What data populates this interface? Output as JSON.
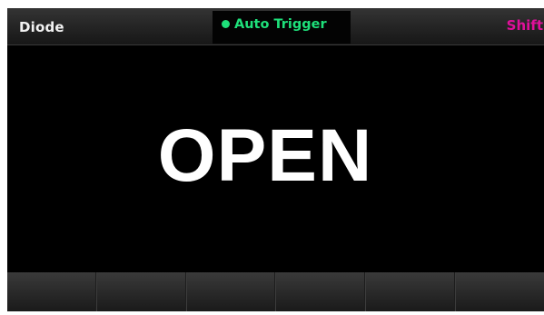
{
  "status_bar": {
    "mode": "Diode",
    "trigger": {
      "label": "Auto Trigger",
      "indicator_icon": "status-dot-icon",
      "color": "#1ee07a"
    },
    "shift": {
      "label": "Shift",
      "color": "#e0109a"
    }
  },
  "main": {
    "reading": "OPEN"
  },
  "softkeys": [
    {
      "label": ""
    },
    {
      "label": ""
    },
    {
      "label": ""
    },
    {
      "label": ""
    },
    {
      "label": ""
    },
    {
      "label": ""
    }
  ],
  "colors": {
    "background": "#000000",
    "text": "#ffffff"
  }
}
